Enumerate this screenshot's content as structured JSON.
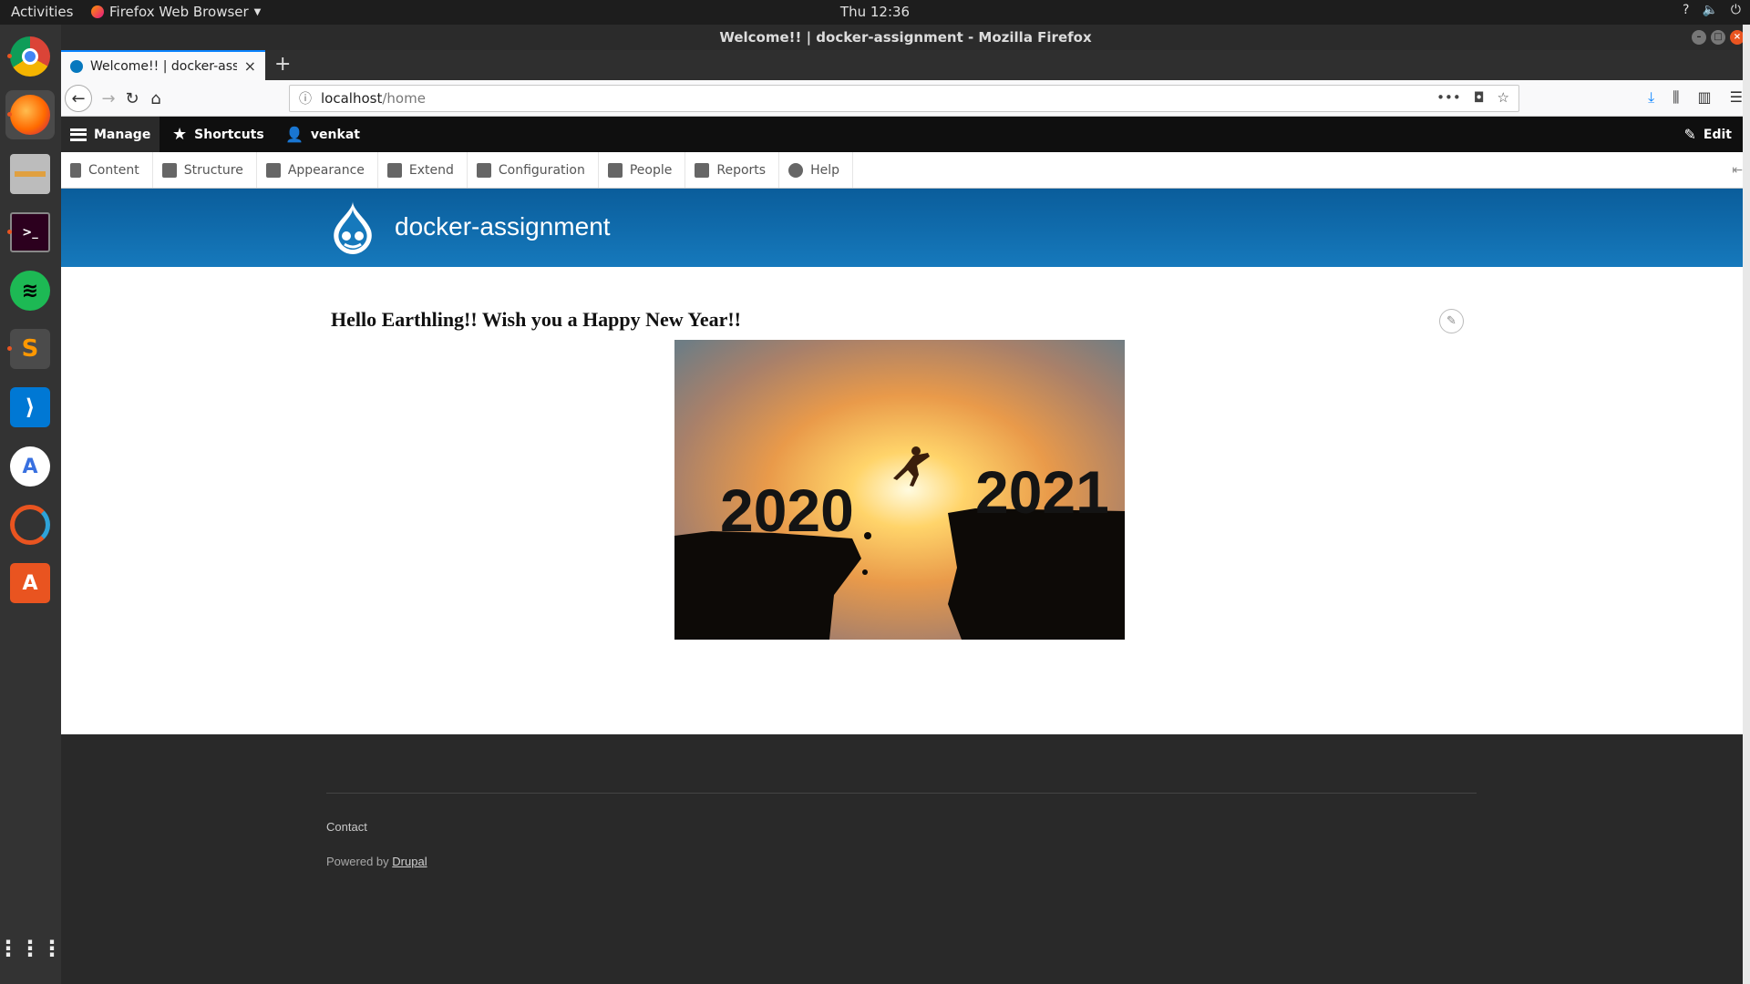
{
  "system": {
    "activities": "Activities",
    "app_menu": "Firefox Web Browser",
    "clock": "Thu 12:36",
    "tray": [
      "?",
      "🔈",
      "⏻"
    ]
  },
  "dock": [
    "Chrome",
    "Firefox",
    "Files",
    "Terminal",
    "Spotify",
    "Sublime Text",
    "VS Code",
    "Android Studio",
    "Ubuntu Software Updater",
    "Ubuntu Software",
    "Show Applications"
  ],
  "window": {
    "title": "Welcome!! | docker-assignment - Mozilla Firefox"
  },
  "tab": {
    "title": "Welcome!! | docker-assic",
    "close": "×",
    "new": "+"
  },
  "url": {
    "host": "localhost",
    "path": "/home"
  },
  "toolbar": {
    "manage": "Manage",
    "shortcuts": "Shortcuts",
    "user": "venkat",
    "edit": "Edit"
  },
  "tray": {
    "items": [
      "Content",
      "Structure",
      "Appearance",
      "Extend",
      "Configuration",
      "People",
      "Reports",
      "Help"
    ]
  },
  "site": {
    "name": "docker-assignment"
  },
  "node": {
    "title": "Hello Earthling!! Wish you a Happy New Year!!",
    "image_text_left": "2020",
    "image_text_right": "2021"
  },
  "footer": {
    "contact": "Contact",
    "powered_prefix": "Powered by",
    "powered_link": "Drupal"
  },
  "colors": {
    "drupal_blue": "#0678be",
    "firefox_accent": "#0a84ff",
    "ubuntu_orange": "#e95420"
  }
}
